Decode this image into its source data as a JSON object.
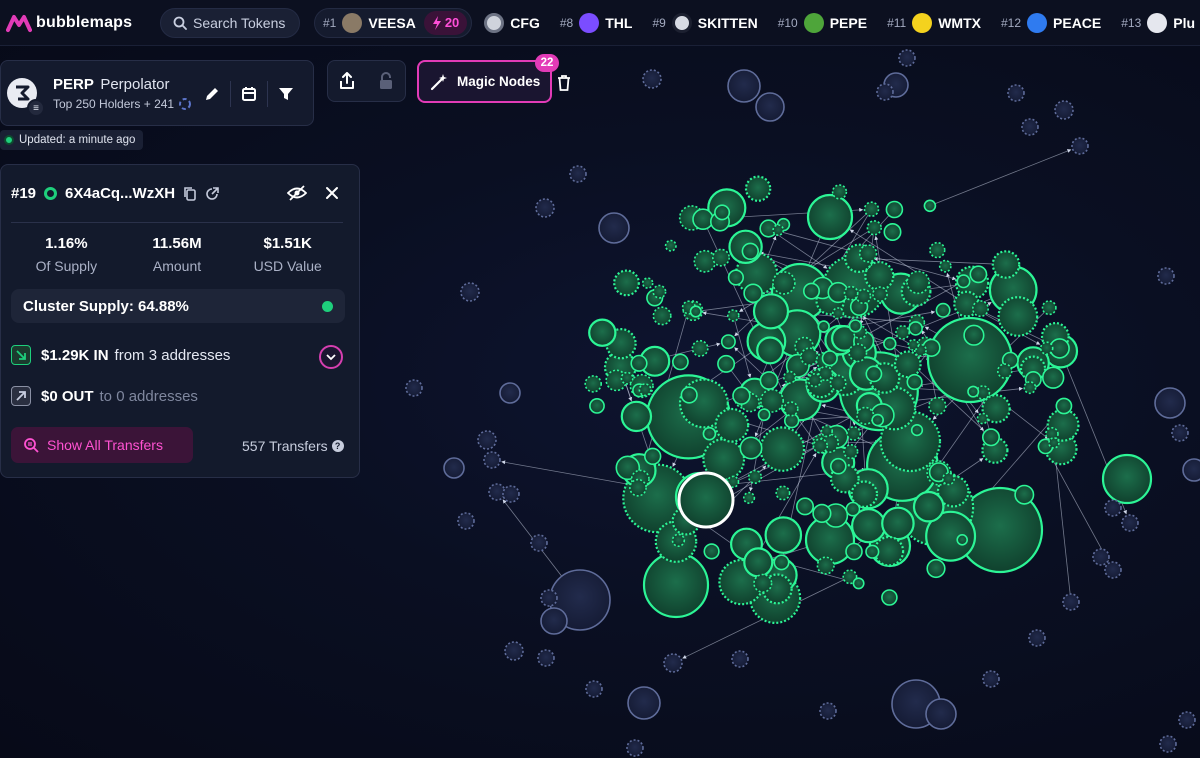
{
  "app": {
    "logo_text": "bubblemaps"
  },
  "search": {
    "label": "Search Tokens",
    "icon": "search-icon"
  },
  "ticker": [
    {
      "rank": "#1",
      "symbol": "VEESA",
      "boost": "20",
      "icon_color": "#8a7a66"
    },
    {
      "rank": "",
      "symbol": "CFG",
      "icon_color": "#cfd3dc"
    },
    {
      "rank": "#8",
      "symbol": "THL",
      "icon_color": "#7b4dff"
    },
    {
      "rank": "#9",
      "symbol": "SKITTEN",
      "icon_color": "#d8dbe4"
    },
    {
      "rank": "#10",
      "symbol": "PEPE",
      "icon_color": "#4ea53a"
    },
    {
      "rank": "#11",
      "symbol": "WMTX",
      "icon_color": "#f4d21e"
    },
    {
      "rank": "#12",
      "symbol": "PEACE",
      "icon_color": "#2f7bf0"
    },
    {
      "rank": "#13",
      "symbol": "Plu",
      "icon_color": "#e5e7ee"
    }
  ],
  "token": {
    "symbol": "PERP",
    "name": "Perpolator",
    "subtitle": "Top 250 Holders + 241",
    "chain_icon": "solana-icon"
  },
  "updated": {
    "label": "Updated: a minute ago"
  },
  "magic_nodes": {
    "label": "Magic Nodes",
    "count": "22"
  },
  "wallet": {
    "rank": "#19",
    "address": "6X4aCq...WzXH",
    "stats": [
      {
        "value": "1.16%",
        "label": "Of Supply"
      },
      {
        "value": "11.56M",
        "label": "Amount"
      },
      {
        "value": "$1.51K",
        "label": "USD Value"
      }
    ],
    "cluster_supply": "Cluster Supply: 64.88%",
    "inflow": {
      "amount": "$1.29K IN",
      "desc": "from 3 addresses"
    },
    "outflow": {
      "amount": "$0 OUT",
      "desc": "to 0 addresses"
    },
    "show_all_label": "Show All Transfers",
    "transfers_count": "557 Transfers"
  },
  "colors": {
    "accent": "#e23bb7",
    "node_green": "#1ecf7c",
    "node_blue": "#1b2445",
    "background": "#0a0f22"
  }
}
